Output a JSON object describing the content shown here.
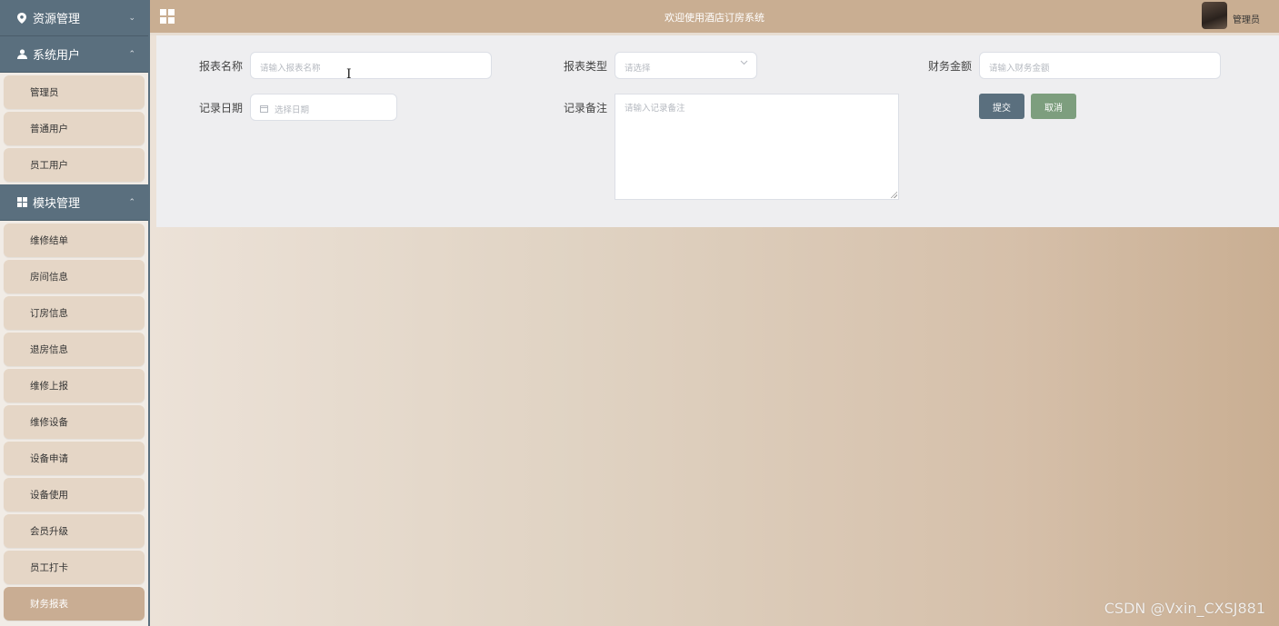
{
  "sidebar": {
    "group_resource": {
      "label": "资源管理",
      "icon": "location-pin-icon",
      "chevron": "⌄"
    },
    "group_users": {
      "label": "系统用户",
      "icon": "user-icon",
      "chevron": "⌃",
      "items": [
        "管理员",
        "普通用户",
        "员工用户"
      ]
    },
    "group_modules": {
      "label": "模块管理",
      "icon": "grid-icon",
      "chevron": "⌃",
      "items": [
        "维修结单",
        "房间信息",
        "订房信息",
        "退房信息",
        "维修上报",
        "维修设备",
        "设备申请",
        "设备使用",
        "会员升级",
        "员工打卡",
        "财务报表"
      ],
      "active": "财务报表"
    }
  },
  "header": {
    "title": "欢迎使用酒店订房系统",
    "username": "管理员"
  },
  "form": {
    "report_name": {
      "label": "报表名称",
      "placeholder": "请输入报表名称"
    },
    "report_type": {
      "label": "报表类型",
      "placeholder": "请选择"
    },
    "amount": {
      "label": "财务金额",
      "placeholder": "请输入财务金额"
    },
    "record_date": {
      "label": "记录日期",
      "placeholder": "选择日期"
    },
    "record_note": {
      "label": "记录备注",
      "placeholder": "请输入记录备注"
    },
    "submit_label": "提交",
    "cancel_label": "取消"
  },
  "watermark": "CSDN @Vxin_CXSJ881",
  "colors": {
    "sidebar_header": "#5a6f7e",
    "menu_item": "#e5d6c6",
    "menu_active": "#c9ad93",
    "topbar": "#c9ae92",
    "submit_button": "#5a6f7e",
    "cancel_button": "#7d9e7e"
  }
}
